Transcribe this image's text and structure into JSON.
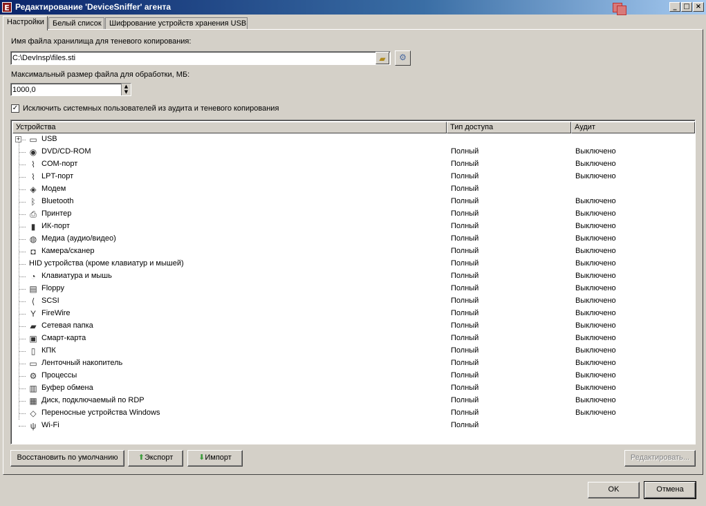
{
  "window": {
    "title": "Редактирование 'DeviceSniffer' агента",
    "app_icon_letter": "E"
  },
  "tabs": [
    {
      "label": "Настройки",
      "active": true
    },
    {
      "label": "Белый список",
      "active": false
    },
    {
      "label": "Шифрование устройств хранения USB",
      "active": false
    }
  ],
  "settings": {
    "shadow_file_label": "Имя файла хранилища для теневого копирования:",
    "shadow_file_value": "C:\\DevInsp\\files.sti",
    "max_size_label": "Максимальный размер файла для обработки, МБ:",
    "max_size_value": "1000,0",
    "exclude_system_users_label": "Исключить системных пользователей из аудита и теневого копирования",
    "exclude_system_users_checked": true
  },
  "devices_table": {
    "columns": [
      "Устройства",
      "Тип доступа",
      "Аудит"
    ],
    "rows": [
      {
        "name": "USB",
        "access": "",
        "audit": "",
        "icon": "usb-icon",
        "glyph": "▭"
      },
      {
        "name": "DVD/CD-ROM",
        "access": "Полный",
        "audit": "Выключено",
        "icon": "cdrom-icon",
        "glyph": "◉"
      },
      {
        "name": "COM-порт",
        "access": "Полный",
        "audit": "Выключено",
        "icon": "com-port-icon",
        "glyph": "⌇"
      },
      {
        "name": "LPT-порт",
        "access": "Полный",
        "audit": "Выключено",
        "icon": "lpt-port-icon",
        "glyph": "⌇"
      },
      {
        "name": "Модем",
        "access": "Полный",
        "audit": "",
        "icon": "modem-icon",
        "glyph": "◈"
      },
      {
        "name": "Bluetooth",
        "access": "Полный",
        "audit": "Выключено",
        "icon": "bluetooth-icon",
        "glyph": "ᛒ"
      },
      {
        "name": "Принтер",
        "access": "Полный",
        "audit": "Выключено",
        "icon": "printer-icon",
        "glyph": "⎙"
      },
      {
        "name": "ИК-порт",
        "access": "Полный",
        "audit": "Выключено",
        "icon": "infrared-icon",
        "glyph": "▮"
      },
      {
        "name": "Медиа (аудио/видео)",
        "access": "Полный",
        "audit": "Выключено",
        "icon": "media-icon",
        "glyph": "◍"
      },
      {
        "name": "Камера/сканер",
        "access": "Полный",
        "audit": "Выключено",
        "icon": "camera-icon",
        "glyph": "◘"
      },
      {
        "name": "HID устройства (кроме клавиатур и мышей)",
        "access": "Полный",
        "audit": "Выключено",
        "icon": "hid-icon",
        "glyph": ""
      },
      {
        "name": "Клавиатура и мышь",
        "access": "Полный",
        "audit": "Выключено",
        "icon": "keyboard-mouse-icon",
        "glyph": "◔"
      },
      {
        "name": "Floppy",
        "access": "Полный",
        "audit": "Выключено",
        "icon": "floppy-icon",
        "glyph": "▤"
      },
      {
        "name": "SCSI",
        "access": "Полный",
        "audit": "Выключено",
        "icon": "scsi-icon",
        "glyph": "⟨"
      },
      {
        "name": "FireWire",
        "access": "Полный",
        "audit": "Выключено",
        "icon": "firewire-icon",
        "glyph": "Y"
      },
      {
        "name": "Сетевая папка",
        "access": "Полный",
        "audit": "Выключено",
        "icon": "network-folder-icon",
        "glyph": "▰"
      },
      {
        "name": "Смарт-карта",
        "access": "Полный",
        "audit": "Выключено",
        "icon": "smart-card-icon",
        "glyph": "▣"
      },
      {
        "name": "КПК",
        "access": "Полный",
        "audit": "Выключено",
        "icon": "pda-icon",
        "glyph": "▯"
      },
      {
        "name": "Ленточный накопитель",
        "access": "Полный",
        "audit": "Выключено",
        "icon": "tape-drive-icon",
        "glyph": "▭"
      },
      {
        "name": "Процессы",
        "access": "Полный",
        "audit": "Выключено",
        "icon": "processes-gear-icon",
        "glyph": "⚙"
      },
      {
        "name": "Буфер обмена",
        "access": "Полный",
        "audit": "Выключено",
        "icon": "clipboard-icon",
        "glyph": "▥"
      },
      {
        "name": "Диск, подключаемый по RDP",
        "access": "Полный",
        "audit": "Выключено",
        "icon": "rdp-disk-icon",
        "glyph": "▦"
      },
      {
        "name": "Переносные устройства Windows",
        "access": "Полный",
        "audit": "Выключено",
        "icon": "portable-device-icon",
        "glyph": "◇"
      },
      {
        "name": "Wi-Fi",
        "access": "Полный",
        "audit": "",
        "icon": "wifi-icon",
        "glyph": "ψ"
      }
    ]
  },
  "buttons": {
    "restore_defaults": "Восстановить по умолчанию",
    "export": "Экспорт",
    "import": "Импорт",
    "edit": "Редактировать...",
    "ok": "OK",
    "cancel": "Отмена"
  },
  "colors": {
    "title_start": "#0a246a",
    "title_end": "#a6caf0",
    "face": "#d4d0c8",
    "export_icon": "#3a9a3a"
  }
}
